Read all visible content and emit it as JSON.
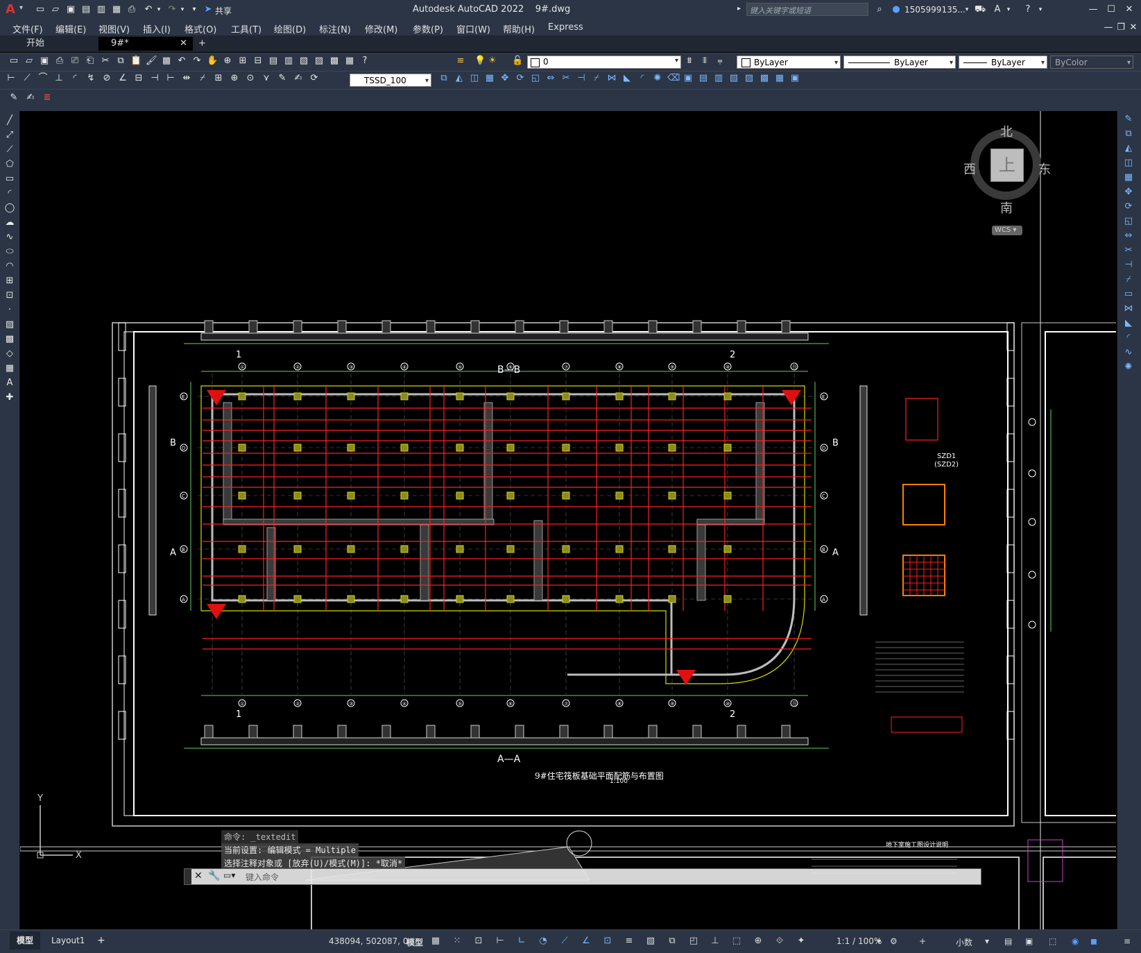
{
  "title": {
    "app": "Autodesk AutoCAD 2022",
    "file": "9#.dwg",
    "share": "共享",
    "search_placeholder": "键入关键字或短语",
    "user": "1505999135..."
  },
  "menu": [
    "文件(F)",
    "编辑(E)",
    "视图(V)",
    "插入(I)",
    "格式(O)",
    "工具(T)",
    "绘图(D)",
    "标注(N)",
    "修改(M)",
    "参数(P)",
    "窗口(W)",
    "帮助(H)",
    "Express"
  ],
  "tabs": [
    {
      "label": "开始"
    },
    {
      "label": "9#*"
    }
  ],
  "layer": {
    "name": "0"
  },
  "properties": {
    "color": "ByLayer",
    "linetype": "ByLayer",
    "lineweight": "ByLayer",
    "plotstyle": "ByColor"
  },
  "dimstyle": "TSSD_100",
  "viewcube": {
    "north": "北",
    "south": "南",
    "east": "东",
    "west": "西",
    "top": "上",
    "wcs": "WCS"
  },
  "drawing": {
    "section_bb": "B—B",
    "section_aa": "A—A",
    "scale_label": "1:100",
    "grid_cols": [
      "①",
      "②",
      "③",
      "④",
      "⑤",
      "⑥",
      "⑦",
      "⑧",
      "⑨",
      "⑩",
      "⑪"
    ],
    "grid_rows": [
      "E",
      "D",
      "C",
      "B",
      "A"
    ],
    "cut_labels": [
      "1",
      "2",
      "A",
      "B"
    ],
    "detail_title": "SZD1",
    "detail_sub": "(SZD2)",
    "plan_title": "9#住宅筏板基础平面配筋与布置图",
    "plan_scale": "1:100",
    "right_title": "地下室施工图设计说明"
  },
  "command": {
    "history": [
      "命令: _textedit",
      "当前设置: 编辑模式 = Multiple",
      "选择注释对象或 [放弃(U)/模式(M)]: *取消*"
    ],
    "placeholder": "键入命令"
  },
  "status": {
    "tabs": [
      "模型",
      "Layout1"
    ],
    "coords": "438094, 502087, 0",
    "space": "模型",
    "scale": "1:1 / 100%",
    "units": "小数"
  }
}
